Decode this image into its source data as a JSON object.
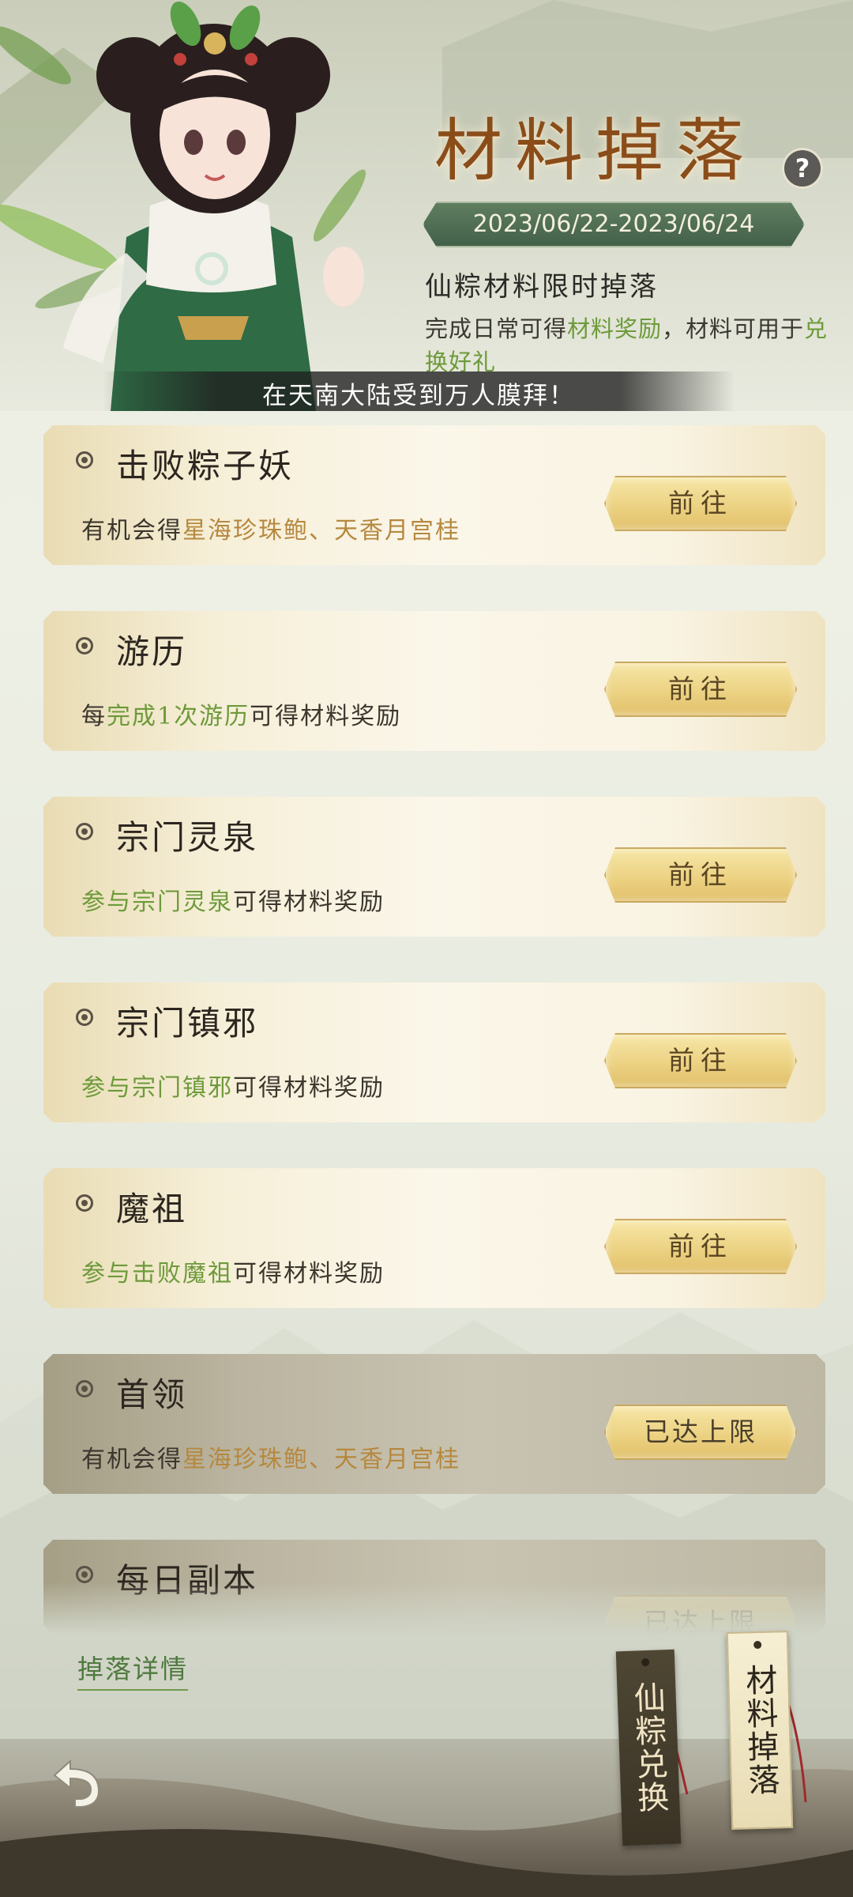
{
  "header": {
    "title": "材料掉落",
    "date_range": "2023/06/22-2023/06/24",
    "subtitle": "仙粽材料限时掉落",
    "desc_parts": [
      "完成日常可得",
      "材料奖励",
      "，材料可用于",
      "兑换好礼"
    ],
    "marquee": "在天南大陆受到万人膜拜！"
  },
  "tasks": [
    {
      "title": "击败粽子妖",
      "desc_parts": [
        "有机会得",
        "星海珍珠鲍、天香月宫桂",
        ""
      ],
      "button": "前往",
      "state": "available"
    },
    {
      "title": "游历",
      "desc_parts": [
        "每",
        "完成1次游历",
        "可得材料奖励"
      ],
      "button": "前往",
      "state": "available"
    },
    {
      "title": "宗门灵泉",
      "desc_parts": [
        "",
        "参与宗门灵泉",
        "可得材料奖励"
      ],
      "button": "前往",
      "state": "available"
    },
    {
      "title": "宗门镇邪",
      "desc_parts": [
        "",
        "参与宗门镇邪",
        "可得材料奖励"
      ],
      "button": "前往",
      "state": "available"
    },
    {
      "title": "魔祖",
      "desc_parts": [
        "",
        "参与击败魔祖",
        "可得材料奖励"
      ],
      "button": "前往",
      "state": "available"
    },
    {
      "title": "首领",
      "desc_parts": [
        "有机会得",
        "星海珍珠鲍、天香月宫桂",
        ""
      ],
      "button": "已达上限",
      "state": "maxed"
    },
    {
      "title": "每日副本",
      "desc_parts": [
        "",
        "",
        ""
      ],
      "button": "已达上限",
      "state": "maxed"
    }
  ],
  "footer": {
    "drop_details": "掉落详情",
    "tag_exchange": "仙粽兑换",
    "tag_drop": "材料掉落"
  },
  "icons": {
    "help": "question-icon",
    "bullet": "radio-dot-icon",
    "back": "back-arrow-icon"
  },
  "colors": {
    "highlight_green": "#6d9a3a",
    "highlight_gold": "#b6883e",
    "date_banner": "#4f6e52"
  }
}
